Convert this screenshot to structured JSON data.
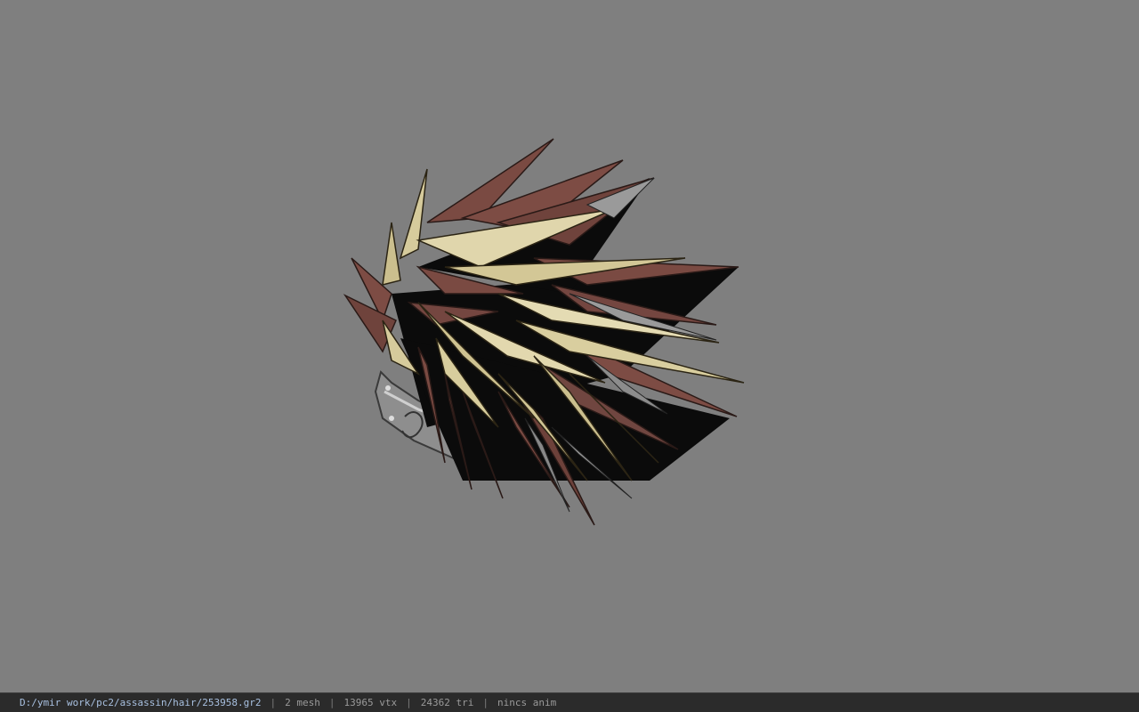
{
  "viewport": {
    "background_color": "#7f7f7f",
    "model_preview": "3d-hair-model-icon"
  },
  "status_bar": {
    "file_path": "D:/ymir work/pc2/assassin/hair/253958.gr2",
    "separator": "|",
    "mesh_count": "2 mesh",
    "vertex_count": "13965 vtx",
    "triangle_count": "24362 tri",
    "anim_status": "nincs anim"
  },
  "colors": {
    "spike_brown": "#7a4a42",
    "spike_brown_dark": "#4e2d28",
    "spike_blond": "#cbbf8e",
    "spike_blond_light": "#e4dbb3",
    "shadow": "#0a0a0a",
    "headband": "#9c9c9c",
    "headband_dark": "#5a5a5a",
    "path_text": "#a8c0e0"
  }
}
